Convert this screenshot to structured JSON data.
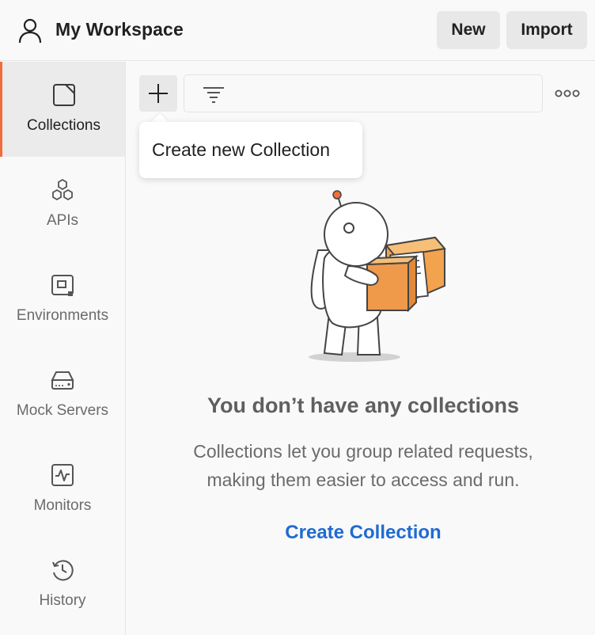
{
  "header": {
    "workspace_title": "My Workspace",
    "new_label": "New",
    "import_label": "Import",
    "user_icon": "user-icon"
  },
  "sidebar": {
    "items": [
      {
        "label": "Collections",
        "icon": "collections-icon",
        "active": true
      },
      {
        "label": "APIs",
        "icon": "apis-icon",
        "active": false
      },
      {
        "label": "Environments",
        "icon": "environments-icon",
        "active": false
      },
      {
        "label": "Mock Servers",
        "icon": "mock-servers-icon",
        "active": false
      },
      {
        "label": "Monitors",
        "icon": "monitors-icon",
        "active": false
      },
      {
        "label": "History",
        "icon": "history-icon",
        "active": false
      }
    ]
  },
  "toolbar": {
    "add_icon": "plus-icon",
    "filter_icon": "filter-icon",
    "more_icon": "more-options-icon"
  },
  "tooltip": {
    "text": "Create new Collection"
  },
  "empty_state": {
    "title": "You don’t have any collections",
    "description_line1": "Collections let you group related requests,",
    "description_line2": "making them easier to access and run.",
    "cta_label": "Create Collection"
  },
  "colors": {
    "accent": "#f26b3a",
    "link": "#1f6bd1",
    "box_orange": "#f0a04b"
  }
}
